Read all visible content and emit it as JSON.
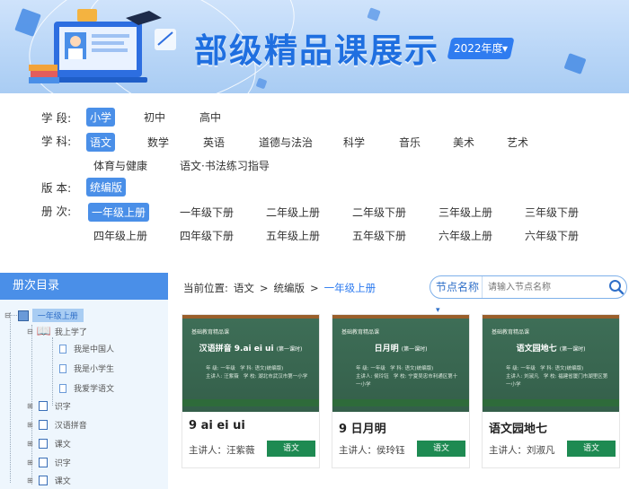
{
  "banner": {
    "title": "部级精品课展示",
    "year": "2022年度"
  },
  "filters": {
    "stage": {
      "label": "学 段:",
      "items": [
        "小学",
        "初中",
        "高中"
      ],
      "active": 0
    },
    "subject": {
      "label": "学 科:",
      "items": [
        "语文",
        "数学",
        "英语",
        "道德与法治",
        "科学",
        "音乐",
        "美术",
        "艺术",
        "体育与健康",
        "语文·书法练习指导"
      ],
      "active": 0
    },
    "edition": {
      "label": "版 本:",
      "items": [
        "统编版"
      ],
      "active": 0
    },
    "volume": {
      "label": "册 次:",
      "items": [
        "一年级上册",
        "一年级下册",
        "二年级上册",
        "二年级下册",
        "三年级上册",
        "三年级下册",
        "四年级上册",
        "四年级下册",
        "五年级上册",
        "五年级下册",
        "六年级上册",
        "六年级下册"
      ],
      "active": 0
    }
  },
  "sidebar": {
    "title": "册次目录",
    "tree": {
      "root": "一年级上册",
      "unit1": "我上学了",
      "lessons": [
        "我是中国人",
        "我是小学生",
        "我爱学语文"
      ],
      "others": [
        "识字",
        "汉语拼音",
        "课文",
        "识字",
        "课文"
      ]
    }
  },
  "breadcrumb": {
    "label": "当前位置:",
    "path": [
      "语文",
      "统编版"
    ],
    "sep": ">",
    "current": "一年级上册"
  },
  "search": {
    "select": "节点名称",
    "placeholder": "请输入节点名称"
  },
  "cards": [
    {
      "board_top": "基础教育精品课",
      "board_title": "汉语拼音 9.ai ei ui",
      "board_sub": "(第一课时)",
      "board_meta_l": "年 级: 一年级",
      "board_meta_r": "学 科: 语文(统编版)",
      "board_meta_l2": "主讲人: 汪紫薇",
      "board_meta_r2": "学 校: 湖北市武汉市第一小学",
      "title": "9 ai ei ui",
      "lecturer": "主讲人：汪紫薇",
      "tag": "语文"
    },
    {
      "board_top": "基础教育精品课",
      "board_title": "日月明",
      "board_sub": "(第一课时)",
      "board_meta_l": "年 级: 一年级",
      "board_meta_r": "学 科: 语文(统编版)",
      "board_meta_l2": "主讲人: 侯玲钰",
      "board_meta_r2": "学 校: 宁夏吴忠市利通区第十一小学",
      "title": "9 日月明",
      "lecturer": "主讲人：侯玲钰",
      "tag": "语文"
    },
    {
      "board_top": "基础教育精品课",
      "board_title": "语文园地七",
      "board_sub": "(第一课时)",
      "board_meta_l": "年 级: 一年级",
      "board_meta_r": "学 科: 语文(统编版)",
      "board_meta_l2": "主讲人: 刘淑凡",
      "board_meta_r2": "学 校: 福建省厦门市湖里区第一小学",
      "title": "语文园地七",
      "lecturer": "主讲人：刘淑凡",
      "tag": "语文"
    }
  ],
  "colors": {
    "accent": "#4a8fe8",
    "tag": "#1e8a52",
    "title_blue": "#1f6fe0"
  }
}
